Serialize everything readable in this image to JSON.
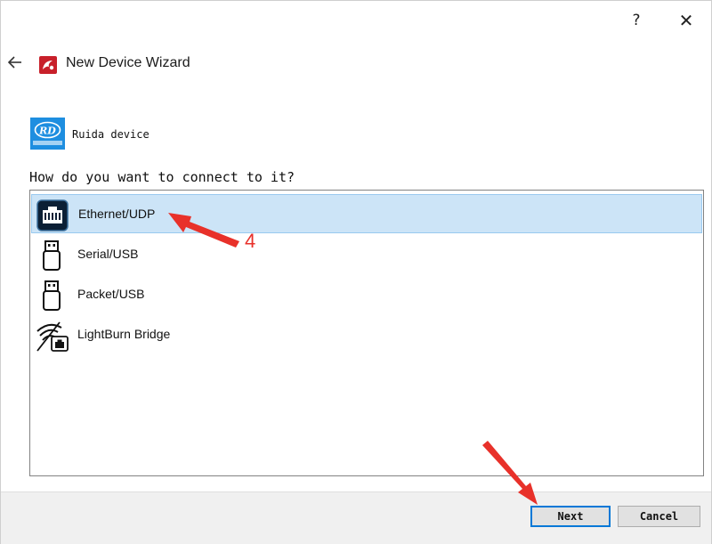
{
  "window": {
    "help_label": "?",
    "close_label": "✕"
  },
  "header": {
    "back_icon": "arrow-left-icon",
    "app_icon": "lightburn-icon",
    "title": "New Device Wizard"
  },
  "device": {
    "logo_icon": "ruida-logo",
    "name": "Ruida device"
  },
  "prompt": "How do you want to connect to it?",
  "connections": [
    {
      "label": "Ethernet/UDP",
      "icon": "ethernet-icon",
      "selected": true
    },
    {
      "label": "Serial/USB",
      "icon": "usb-icon",
      "selected": false
    },
    {
      "label": "Packet/USB",
      "icon": "usb-icon",
      "selected": false
    },
    {
      "label": "LightBurn Bridge",
      "icon": "wifi-bridge-icon",
      "selected": false
    }
  ],
  "buttons": {
    "next": "Next",
    "cancel": "Cancel"
  },
  "annotation": {
    "step": "4",
    "color": "#e8312a"
  },
  "colors": {
    "selection_bg": "#cce4f7",
    "selection_border": "#99c9ef",
    "focus_border": "#0078d7"
  }
}
